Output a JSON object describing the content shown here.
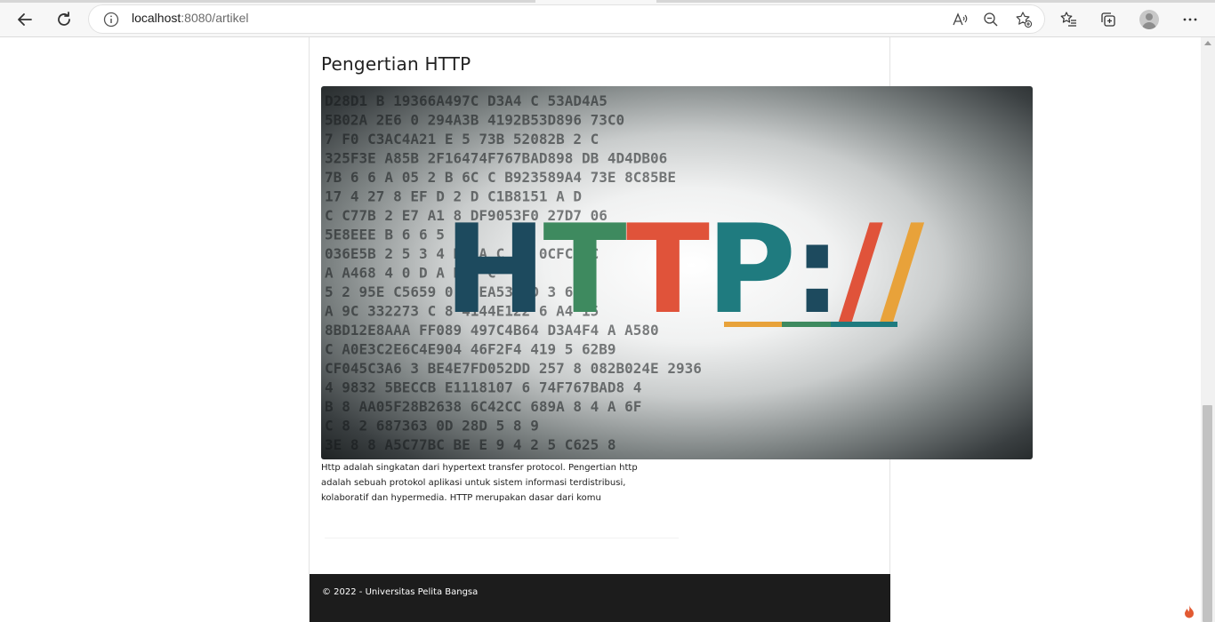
{
  "browser": {
    "url_host": "localhost",
    "url_rest": ":8080/artikel"
  },
  "article": {
    "title": "Pengertian HTTP",
    "image_text": "HTTP://",
    "image_code_lines": [
      "D28D1  B 19366A497C   D3A4 C   53AD4A5",
      "5B02A  2E6  0  294A3B  4192B53D896  73C0",
      "7 F0  C3AC4A21  E   5  73B 52082B  2  C",
      "325F3E  A85B   2F16474F767BAD898  DB   4D4DB06",
      "7B 6  6   A  05 2 B   6C  C  B923589A4  73E  8C85BE",
      "17  4   27  8  EF D 2 D  C1B8151  A    D",
      "C  C77B  2 E7  A1  8   DF9053F0  27D7   06",
      "5E8EEE  B   6   6                    5",
      "036E5B  2  5  3  4  DE      A   C  F3  0CFC6  C",
      "    A  A468 4 0  D    A      D  8   C",
      "    5  2 95E  C5659 0   DFEA532  D 3  6  B",
      "A   9C   332273    C   8   4144E122   6  A4  15",
      "8BD12E8AAA  FF089   497C4B64  D3A4F4   A  A580",
      "  C  A0E3C2E6C4E904   46F2F4  419   5  62B9",
      "  CF045C3A6 3  BE4E7FD052DD 257 8  082B024E  2936",
      "4  9832  5BECCB  E1118107   6  74F767BAD8   4",
      "  B 8  AA05F28B2638 6C42CC   689A  8 4 A  6F",
      "  C  8   2 687363 0D 28D  5 8   9",
      "3E  8 8 A5C77BC  BE    E   9  4  2   5  C625  8"
    ],
    "summary": "Http adalah singkatan dari hypertext transfer protocol. Pengertian http adalah sebuah protokol aplikasi untuk sistem informasi terdistribusi, kolaboratif dan hypermedia. HTTP merupakan dasar dari komu"
  },
  "footer": {
    "copyright": "© 2022 - Universitas Pelita Bangsa"
  },
  "colors": {
    "navy": "#1d4a5e",
    "green": "#3e8a5f",
    "red": "#e0533a",
    "teal": "#1f7b7f",
    "orange": "#e8a23a"
  }
}
